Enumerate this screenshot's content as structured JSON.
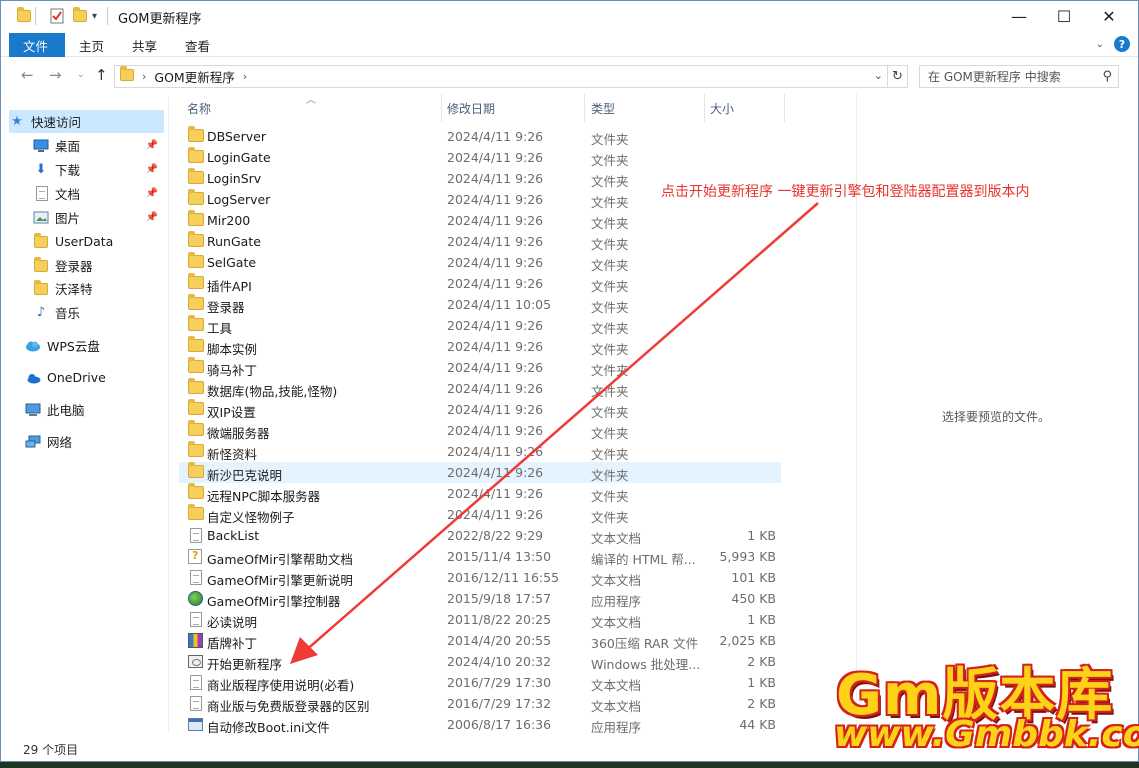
{
  "window": {
    "title": "GOM更新程序",
    "controls": {
      "minimize": "—",
      "maximize": "☐",
      "close": "✕"
    }
  },
  "ribbon": {
    "tabs": [
      {
        "label": "文件",
        "active": true
      },
      {
        "label": "主页",
        "active": false
      },
      {
        "label": "共享",
        "active": false
      },
      {
        "label": "查看",
        "active": false
      }
    ],
    "help": "?"
  },
  "address": {
    "path": [
      "GOM更新程序"
    ],
    "search_placeholder": "在 GOM更新程序 中搜索"
  },
  "sidebar": {
    "items": [
      {
        "label": "快速访问",
        "icon": "star-icon",
        "pinned": false,
        "selected": true
      },
      {
        "label": "桌面",
        "icon": "desktop-icon",
        "pinned": true
      },
      {
        "label": "下载",
        "icon": "download-icon",
        "pinned": true
      },
      {
        "label": "文档",
        "icon": "document-icon",
        "pinned": true
      },
      {
        "label": "图片",
        "icon": "picture-icon",
        "pinned": true
      },
      {
        "label": "UserData",
        "icon": "folder-icon",
        "pinned": false
      },
      {
        "label": "登录器",
        "icon": "folder-icon",
        "pinned": false
      },
      {
        "label": "沃泽特",
        "icon": "folder-icon",
        "pinned": false
      },
      {
        "label": "音乐",
        "icon": "music-icon",
        "pinned": false
      },
      {
        "label": "WPS云盘",
        "icon": "cloud-icon",
        "pinned": false
      },
      {
        "label": "OneDrive",
        "icon": "onedrive-icon",
        "pinned": false
      },
      {
        "label": "此电脑",
        "icon": "computer-icon",
        "pinned": false
      },
      {
        "label": "网络",
        "icon": "network-icon",
        "pinned": false
      }
    ]
  },
  "columns": {
    "name": "名称",
    "date": "修改日期",
    "type": "类型",
    "size": "大小"
  },
  "files": [
    {
      "name": "DBServer",
      "date": "2024/4/11 9:26",
      "type": "文件夹",
      "size": "",
      "icon": "folder"
    },
    {
      "name": "LoginGate",
      "date": "2024/4/11 9:26",
      "type": "文件夹",
      "size": "",
      "icon": "folder"
    },
    {
      "name": "LoginSrv",
      "date": "2024/4/11 9:26",
      "type": "文件夹",
      "size": "",
      "icon": "folder"
    },
    {
      "name": "LogServer",
      "date": "2024/4/11 9:26",
      "type": "文件夹",
      "size": "",
      "icon": "folder"
    },
    {
      "name": "Mir200",
      "date": "2024/4/11 9:26",
      "type": "文件夹",
      "size": "",
      "icon": "folder"
    },
    {
      "name": "RunGate",
      "date": "2024/4/11 9:26",
      "type": "文件夹",
      "size": "",
      "icon": "folder"
    },
    {
      "name": "SelGate",
      "date": "2024/4/11 9:26",
      "type": "文件夹",
      "size": "",
      "icon": "folder"
    },
    {
      "name": "插件API",
      "date": "2024/4/11 9:26",
      "type": "文件夹",
      "size": "",
      "icon": "folder"
    },
    {
      "name": "登录器",
      "date": "2024/4/11 10:05",
      "type": "文件夹",
      "size": "",
      "icon": "folder"
    },
    {
      "name": "工具",
      "date": "2024/4/11 9:26",
      "type": "文件夹",
      "size": "",
      "icon": "folder"
    },
    {
      "name": "脚本实例",
      "date": "2024/4/11 9:26",
      "type": "文件夹",
      "size": "",
      "icon": "folder"
    },
    {
      "name": "骑马补丁",
      "date": "2024/4/11 9:26",
      "type": "文件夹",
      "size": "",
      "icon": "folder"
    },
    {
      "name": "数据库(物品,技能,怪物)",
      "date": "2024/4/11 9:26",
      "type": "文件夹",
      "size": "",
      "icon": "folder"
    },
    {
      "name": "双IP设置",
      "date": "2024/4/11 9:26",
      "type": "文件夹",
      "size": "",
      "icon": "folder"
    },
    {
      "name": "微端服务器",
      "date": "2024/4/11 9:26",
      "type": "文件夹",
      "size": "",
      "icon": "folder"
    },
    {
      "name": "新怪资料",
      "date": "2024/4/11 9:26",
      "type": "文件夹",
      "size": "",
      "icon": "folder"
    },
    {
      "name": "新沙巴克说明",
      "date": "2024/4/11 9:26",
      "type": "文件夹",
      "size": "",
      "icon": "folder",
      "hover": true
    },
    {
      "name": "远程NPC脚本服务器",
      "date": "2024/4/11 9:26",
      "type": "文件夹",
      "size": "",
      "icon": "folder"
    },
    {
      "name": "自定义怪物例子",
      "date": "2024/4/11 9:26",
      "type": "文件夹",
      "size": "",
      "icon": "folder"
    },
    {
      "name": "BackList",
      "date": "2022/8/22 9:29",
      "type": "文本文档",
      "size": "1 KB",
      "icon": "doc"
    },
    {
      "name": "GameOfMir引擎帮助文档",
      "date": "2015/11/4 13:50",
      "type": "编译的 HTML 帮...",
      "size": "5,993 KB",
      "icon": "html"
    },
    {
      "name": "GameOfMir引擎更新说明",
      "date": "2016/12/11 16:55",
      "type": "文本文档",
      "size": "101 KB",
      "icon": "doc"
    },
    {
      "name": "GameOfMir引擎控制器",
      "date": "2015/9/18 17:57",
      "type": "应用程序",
      "size": "450 KB",
      "icon": "app"
    },
    {
      "name": "必读说明",
      "date": "2011/8/22 20:25",
      "type": "文本文档",
      "size": "1 KB",
      "icon": "doc"
    },
    {
      "name": "盾牌补丁",
      "date": "2014/4/20 20:55",
      "type": "360压缩 RAR 文件",
      "size": "2,025 KB",
      "icon": "rar"
    },
    {
      "name": "开始更新程序",
      "date": "2024/4/10 20:32",
      "type": "Windows 批处理...",
      "size": "2 KB",
      "icon": "bat"
    },
    {
      "name": "商业版程序使用说明(必看)",
      "date": "2016/7/29 17:30",
      "type": "文本文档",
      "size": "1 KB",
      "icon": "doc"
    },
    {
      "name": "商业版与免费版登录器的区别",
      "date": "2016/7/29 17:32",
      "type": "文本文档",
      "size": "2 KB",
      "icon": "doc"
    },
    {
      "name": "自动修改Boot.ini文件",
      "date": "2006/8/17 16:36",
      "type": "应用程序",
      "size": "44 KB",
      "icon": "exe"
    }
  ],
  "preview": {
    "empty_text": "选择要预览的文件。"
  },
  "status": {
    "item_count": "29 个项目"
  },
  "annotation": {
    "text": "点击开始更新程序 一键更新引擎包和登陆器配置器到版本内",
    "color": "#e8322e"
  },
  "watermark": {
    "line1": "Gm版本库",
    "line2": "www.Gmbbk.com"
  }
}
